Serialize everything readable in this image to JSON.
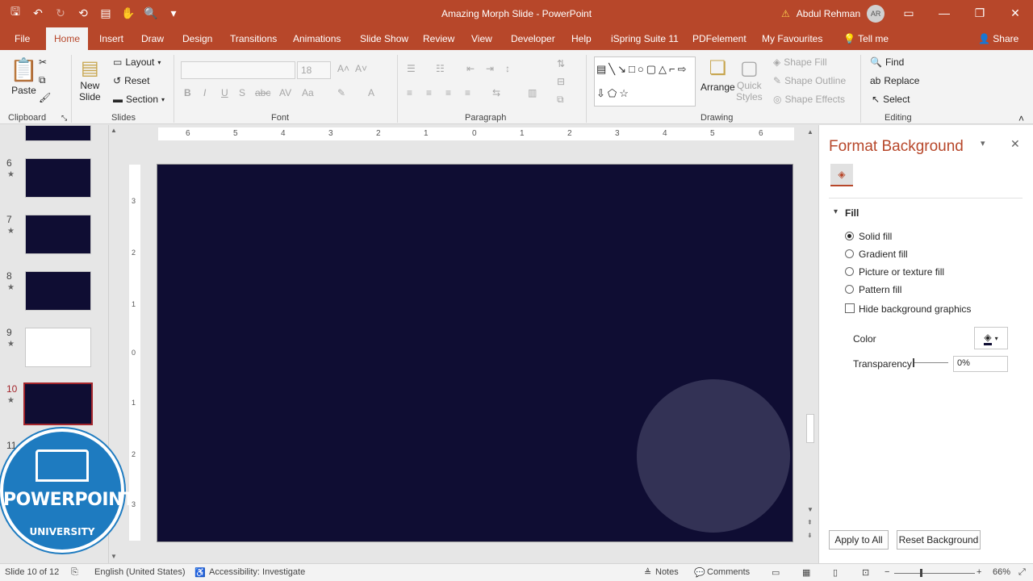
{
  "window": {
    "doc_title": "Amazing Morph Slide  -  PowerPoint",
    "user_name": "Abdul Rehman",
    "user_initials": "AR"
  },
  "tabs": [
    "File",
    "Home",
    "Insert",
    "Draw",
    "Design",
    "Transitions",
    "Animations",
    "Slide Show",
    "Review",
    "View",
    "Developer",
    "Help",
    "iSpring Suite 11",
    "PDFelement",
    "My Favourites",
    "Tell me"
  ],
  "active_tab": "Home",
  "share_label": "Share",
  "ribbon": {
    "clipboard": {
      "paste": "Paste",
      "label": "Clipboard"
    },
    "slides": {
      "new_slide_1": "New",
      "new_slide_2": "Slide",
      "layout": "Layout",
      "reset": "Reset",
      "section": "Section",
      "label": "Slides"
    },
    "font": {
      "size": "18",
      "label": "Font"
    },
    "paragraph": {
      "label": "Paragraph"
    },
    "drawing": {
      "arrange": "Arrange",
      "quick_styles_1": "Quick",
      "quick_styles_2": "Styles",
      "shape_fill": "Shape Fill",
      "shape_outline": "Shape Outline",
      "shape_effects": "Shape Effects",
      "label": "Drawing"
    },
    "editing": {
      "find": "Find",
      "replace": "Replace",
      "select": "Select",
      "label": "Editing"
    }
  },
  "thumbnails": [
    {
      "num": "6",
      "star": "★"
    },
    {
      "num": "7",
      "star": "★"
    },
    {
      "num": "8",
      "star": "★"
    },
    {
      "num": "9",
      "star": "★"
    },
    {
      "num": "10",
      "star": "★"
    },
    {
      "num": "11",
      "star": ""
    }
  ],
  "ruler": {
    "h_ticks": [
      "6",
      "5",
      "4",
      "3",
      "2",
      "1",
      "0",
      "1",
      "2",
      "3",
      "4",
      "5",
      "6"
    ],
    "v_ticks": [
      "3",
      "2",
      "1",
      "0",
      "1",
      "2",
      "3"
    ]
  },
  "format_pane": {
    "title": "Format Background",
    "section": "Fill",
    "options": [
      "Solid fill",
      "Gradient fill",
      "Picture or texture fill",
      "Pattern fill"
    ],
    "selected_option": "Solid fill",
    "hide_bg": "Hide background graphics",
    "color_label": "Color",
    "transparency_label": "Transparency",
    "transparency_value": "0%",
    "apply_all": "Apply to All",
    "reset_bg": "Reset Background"
  },
  "logo": {
    "title": "POWERPOINT",
    "subtitle": "UNIVERSITY"
  },
  "status": {
    "slide_info": "Slide 10 of 12",
    "language": "English (United States)",
    "accessibility": "Accessibility: Investigate",
    "notes": "Notes",
    "comments": "Comments",
    "zoom": "66%"
  },
  "colors": {
    "accent": "#b7472a",
    "slide_bg": "#0f0d33",
    "selected_thumb": "#a4262c"
  }
}
